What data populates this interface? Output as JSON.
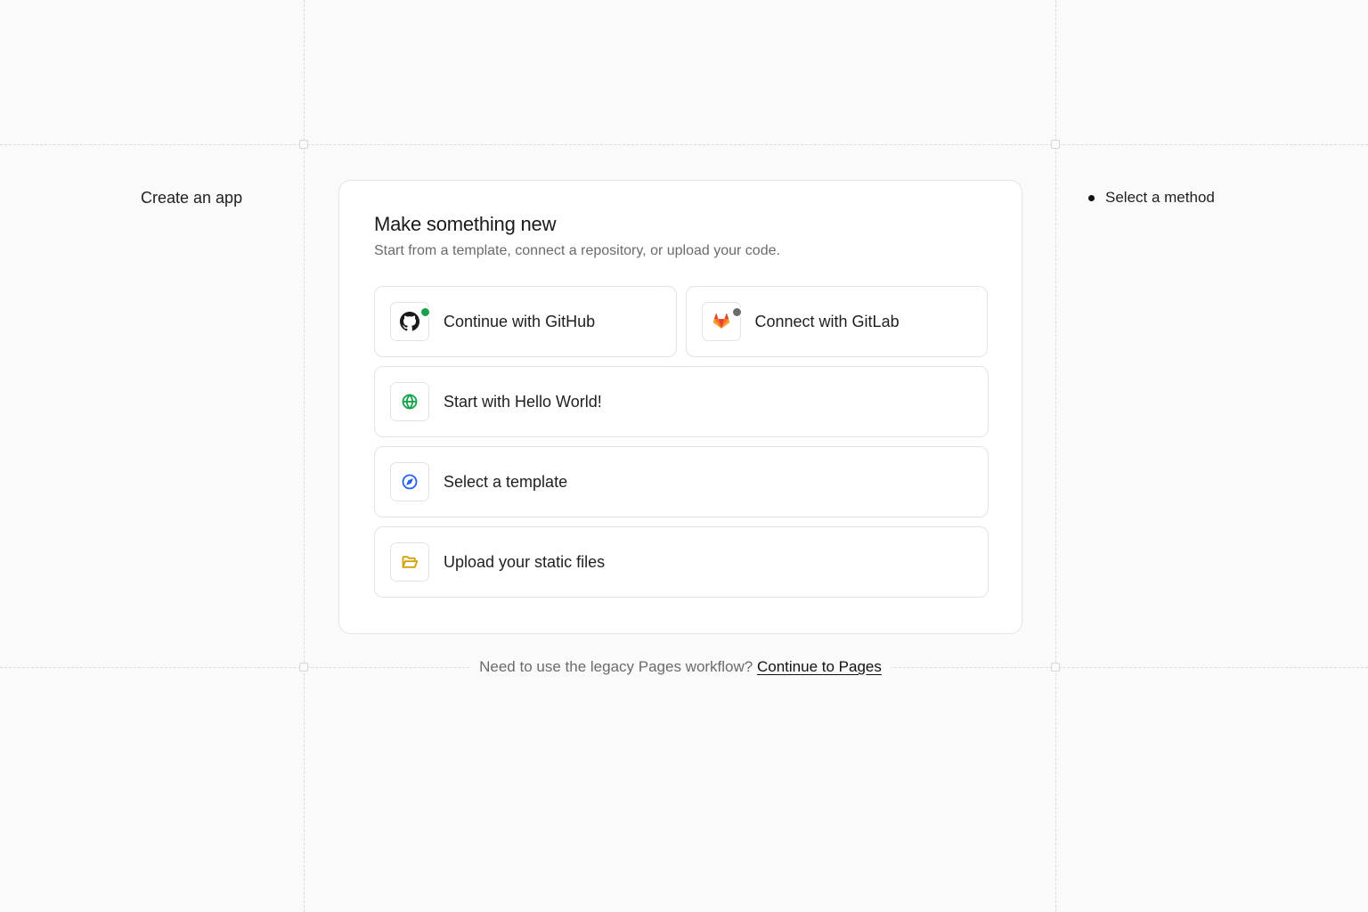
{
  "sidebar": {
    "title": "Create an app"
  },
  "steps": {
    "items": [
      {
        "label": "Select a method"
      }
    ]
  },
  "card": {
    "title": "Make something new",
    "subtitle": "Start from a template, connect a repository, or upload your code."
  },
  "options": {
    "github": {
      "label": "Continue with GitHub",
      "icon": "github-icon",
      "status_color": "#16a34a"
    },
    "gitlab": {
      "label": "Connect with GitLab",
      "icon": "gitlab-icon",
      "status_color": "#6b6b6b"
    },
    "hello_world": {
      "label": "Start with Hello World!",
      "icon": "globe-icon",
      "color": "#16a34a"
    },
    "template": {
      "label": "Select a template",
      "icon": "compass-icon",
      "color": "#2563eb"
    },
    "upload": {
      "label": "Upload your static files",
      "icon": "folder-open-icon",
      "color": "#d4a106"
    }
  },
  "footer": {
    "text": "Need to use the legacy Pages workflow?",
    "link_label": "Continue to Pages"
  }
}
